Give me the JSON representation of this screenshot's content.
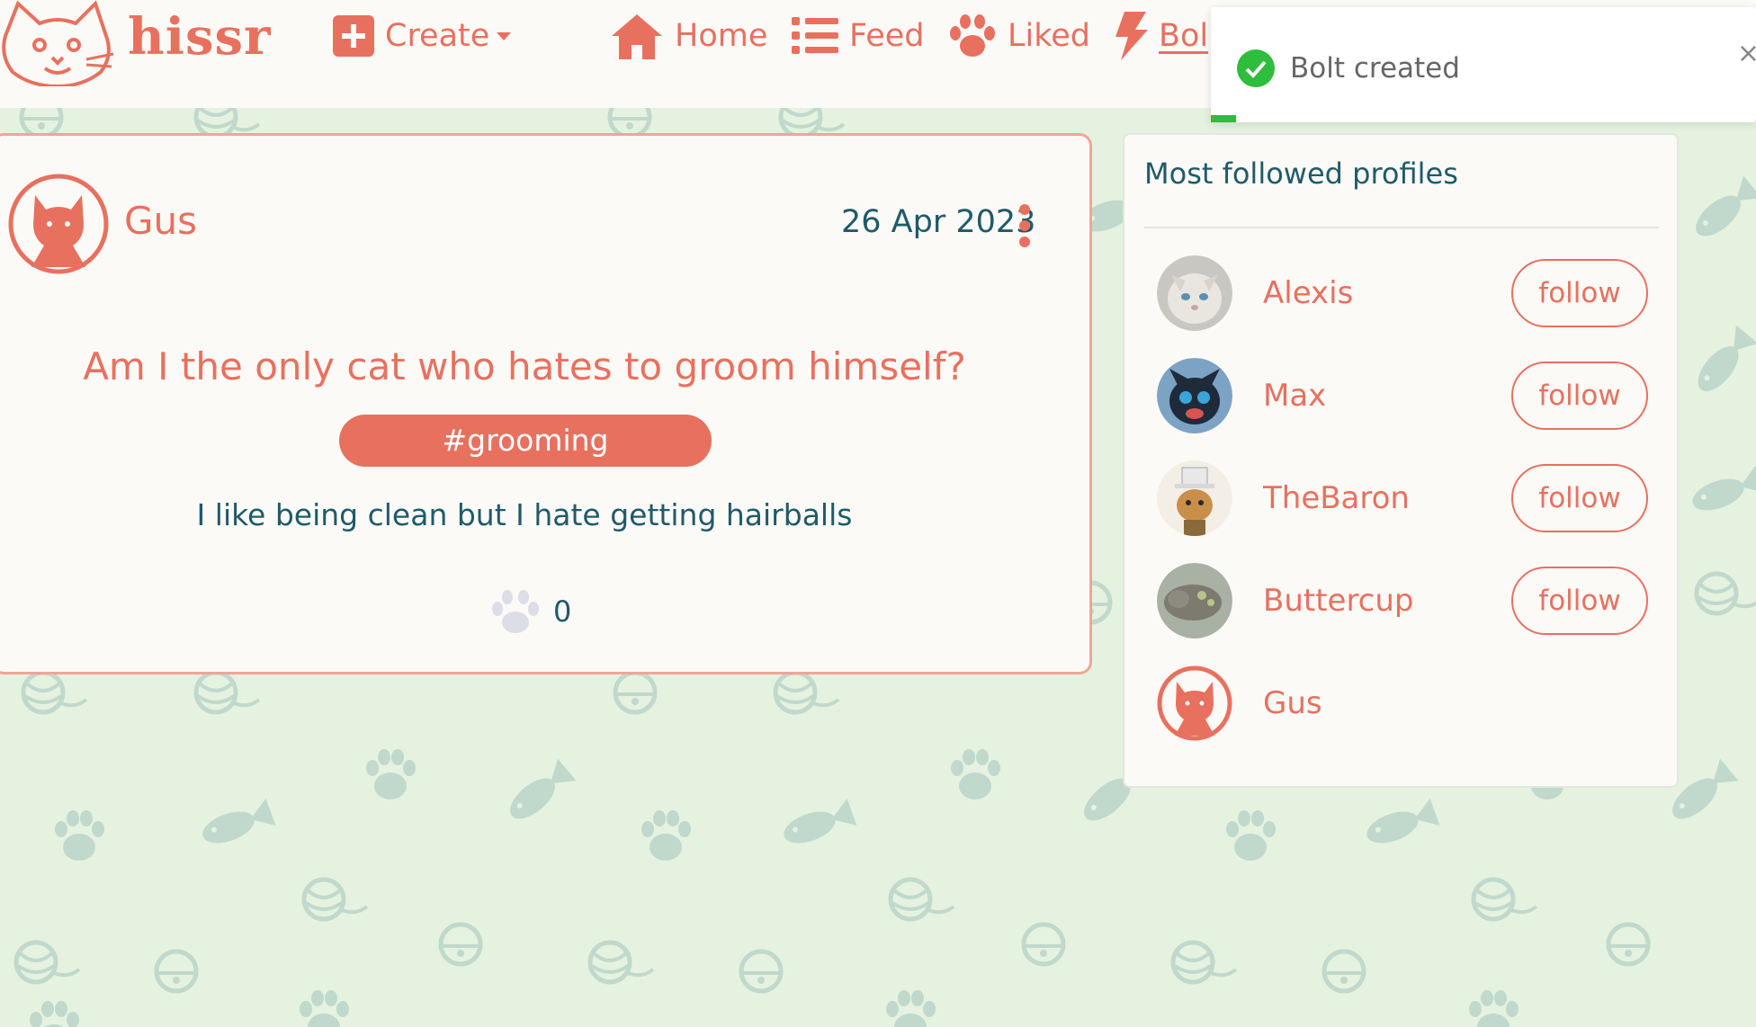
{
  "brand": {
    "name": "hissr",
    "logo_icon": "cat-face-icon"
  },
  "nav": {
    "create_label": "Create",
    "home_label": "Home",
    "feed_label": "Feed",
    "liked_label": "Liked",
    "bolt_label": "Bol"
  },
  "toast": {
    "message": "Bolt created",
    "close": "×",
    "status_color": "#2ebd3c"
  },
  "post": {
    "author": "Gus",
    "date": "26 Apr 2023",
    "title": "Am I the only cat who hates to groom himself?",
    "tag": "#grooming",
    "body": "I like being clean but I hate getting hairballs",
    "likes": "0"
  },
  "sidebar": {
    "title": "Most followed profiles",
    "profiles": [
      {
        "name": "Alexis",
        "follow_label": "follow"
      },
      {
        "name": "Max",
        "follow_label": "follow"
      },
      {
        "name": "TheBaron",
        "follow_label": "follow"
      },
      {
        "name": "Buttercup",
        "follow_label": "follow"
      },
      {
        "name": "Gus"
      }
    ]
  },
  "colors": {
    "accent": "#e8705f",
    "text_dark": "#1f5a6a",
    "background": "#e5f2e0",
    "card": "#fcfaf6"
  }
}
